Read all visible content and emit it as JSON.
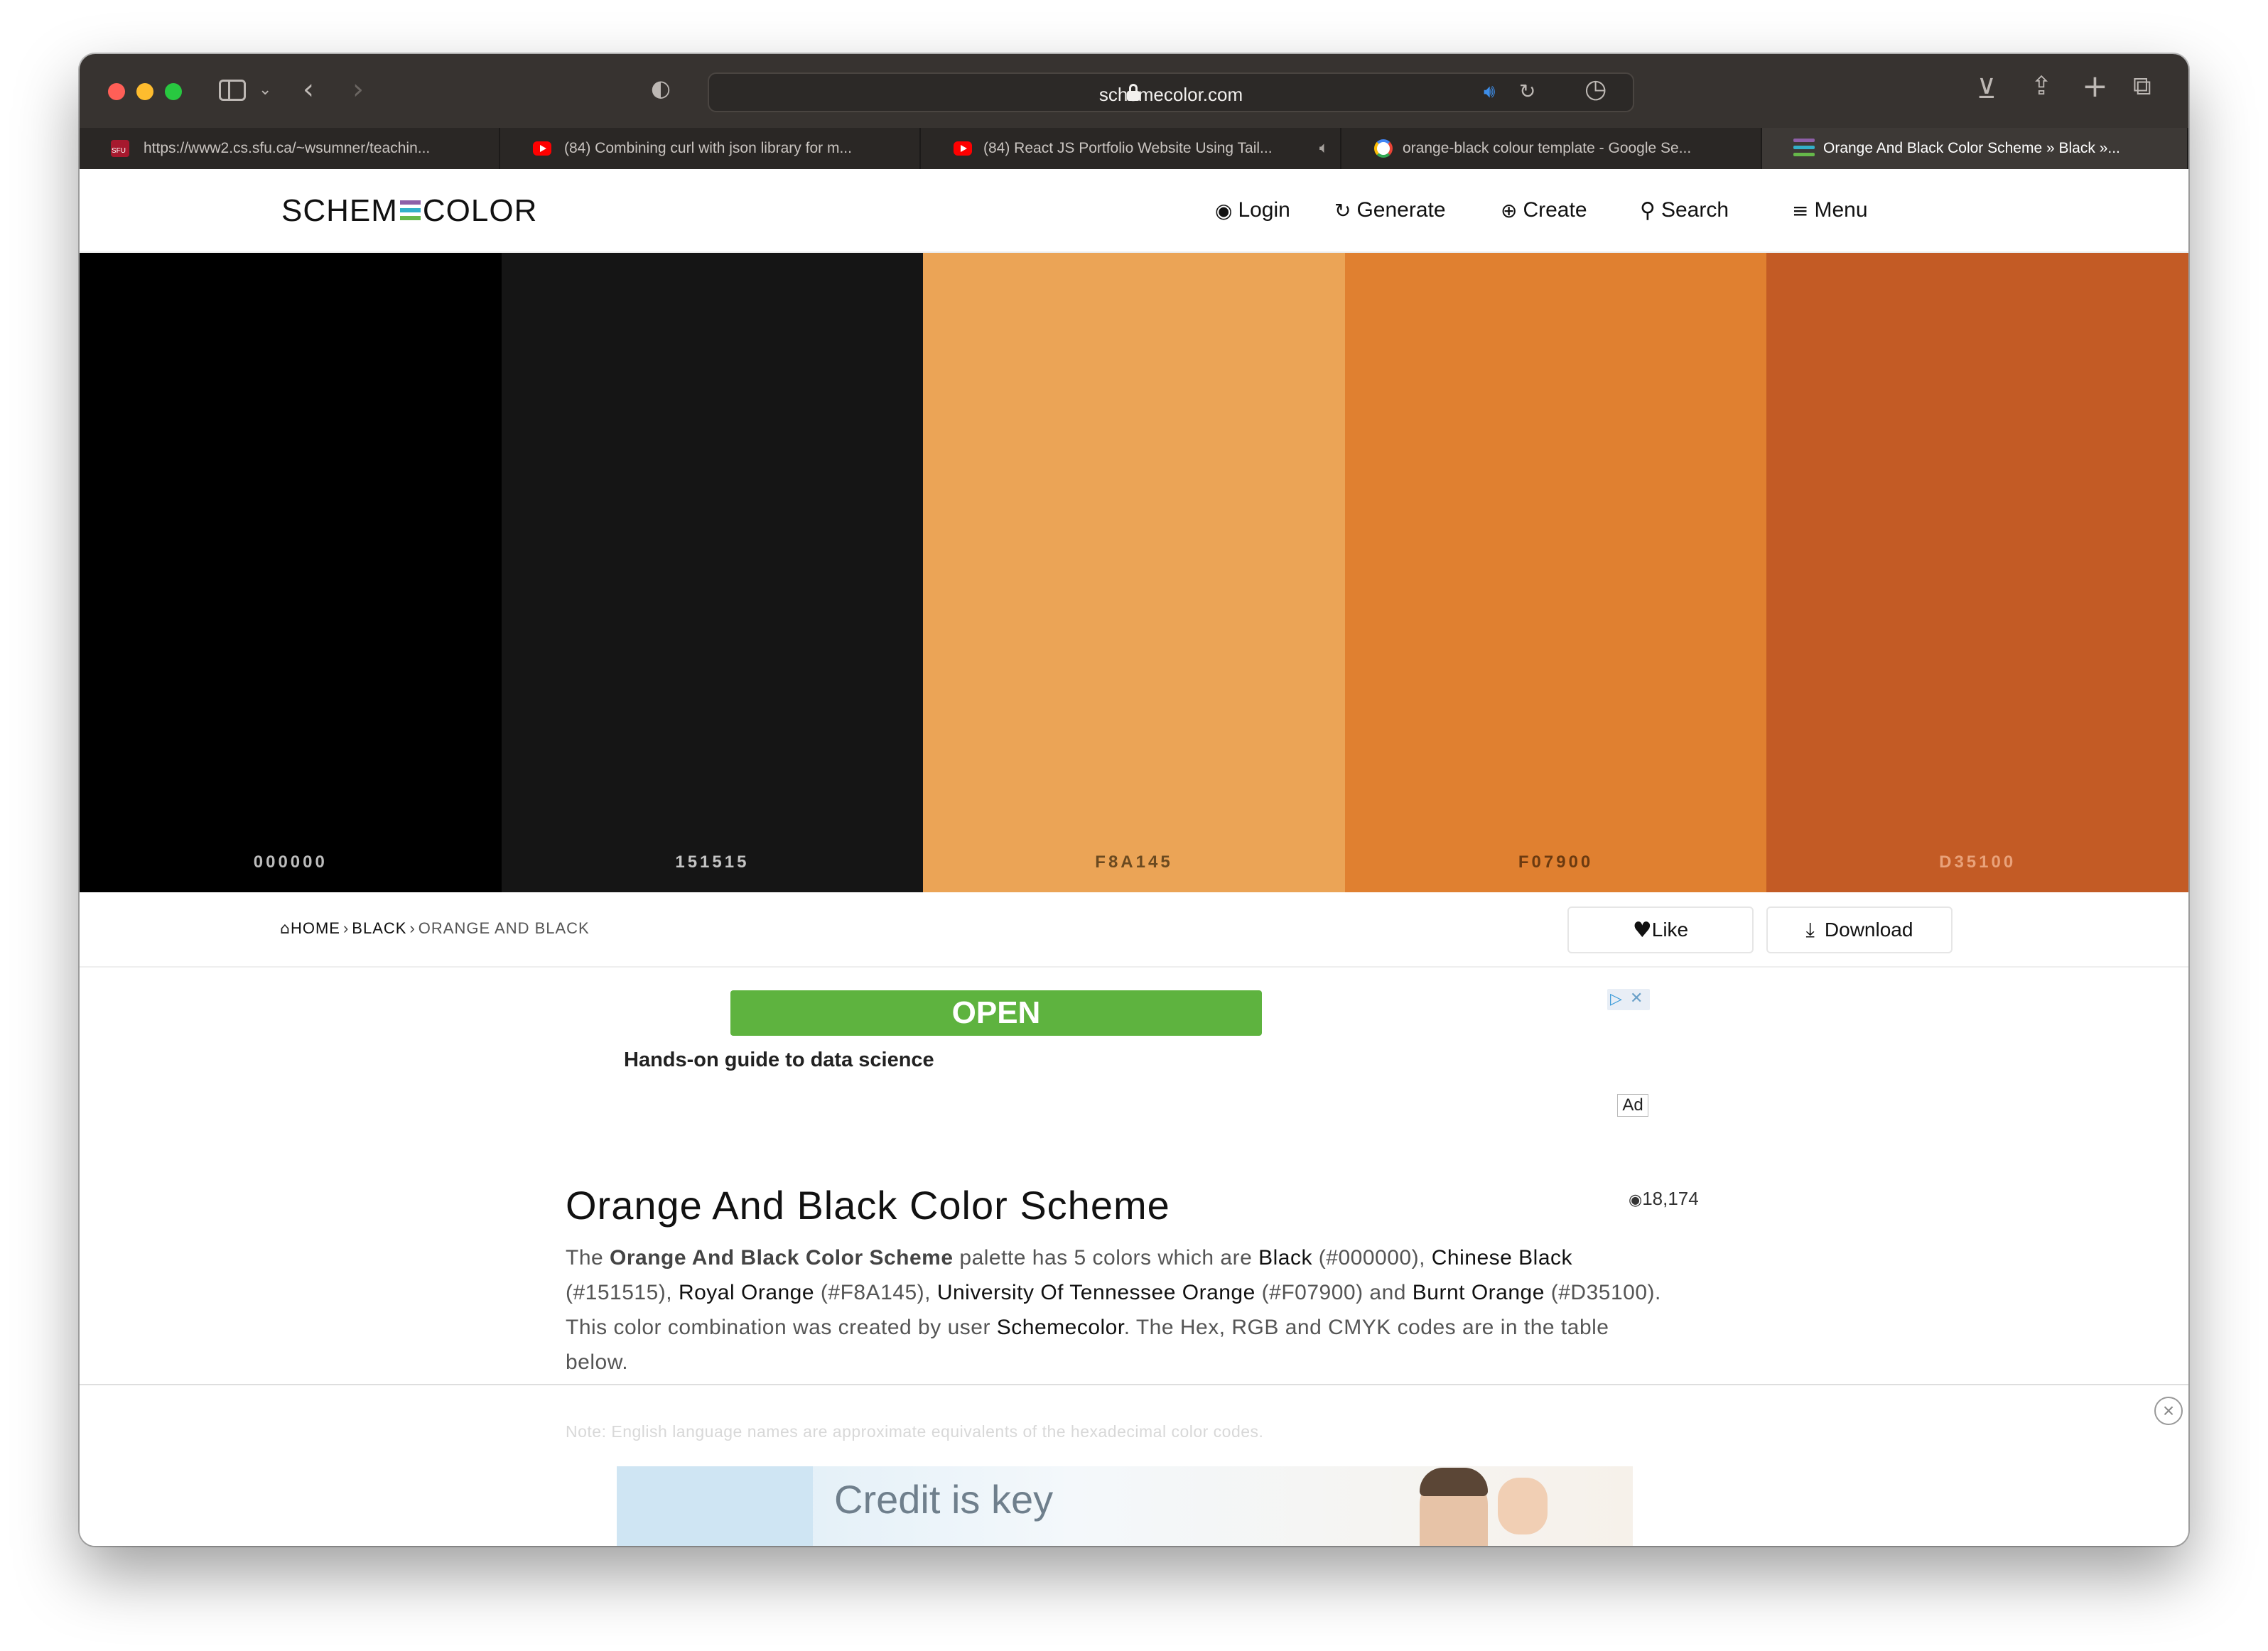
{
  "browser": {
    "url": "schemecolor.com",
    "tabs": [
      {
        "title": "https://www2.cs.sfu.ca/~wsumner/teachin...",
        "favicon": "sfu-icon"
      },
      {
        "title": "(84) Combining curl with json library for m...",
        "favicon": "youtube-icon"
      },
      {
        "title": "(84) React JS Portfolio Website Using Tail...",
        "favicon": "youtube-icon",
        "audio": true
      },
      {
        "title": "orange-black colour template - Google Se...",
        "favicon": "google-icon"
      },
      {
        "title": "Orange And Black Color Scheme » Black »...",
        "favicon": "schemecolor-icon",
        "active": true
      }
    ]
  },
  "site": {
    "logo_left": "SCHEM",
    "logo_right": "COLOR",
    "nav": {
      "login": "Login",
      "generate": "Generate",
      "create": "Create",
      "search": "Search",
      "menu": "Menu"
    }
  },
  "palette": [
    {
      "hex": "000000",
      "color": "#000000",
      "label_color": "#bcbcbc"
    },
    {
      "hex": "151515",
      "color": "#151515",
      "label_color": "#c4c4c4"
    },
    {
      "hex": "F8A145",
      "color": "#EBA456",
      "label_color": "#6b4a20"
    },
    {
      "hex": "F07900",
      "color": "#E08030",
      "label_color": "#6b3a10"
    },
    {
      "hex": "D35100",
      "color": "#C35B25",
      "label_color": "#e9a27a"
    }
  ],
  "breadcrumb": {
    "home": "HOME",
    "black": "BLACK",
    "current": "ORANGE AND BLACK"
  },
  "actions": {
    "like": "Like",
    "download": "Download"
  },
  "ad": {
    "open_label": "OPEN",
    "tagline": "Hands-on guide to data science",
    "badge": "Ad",
    "bottom_text": "Credit is key"
  },
  "article": {
    "title": "Orange And Black Color Scheme",
    "views": "18,174",
    "p1_the": "The ",
    "p1_name": "Orange And Black Color Scheme",
    "p1_mid": " palette has 5 colors which are ",
    "c1_name": "Black",
    "c1_hex": " (#000000), ",
    "c2_name": "Chinese Black",
    "c2_hex": " (#151515), ",
    "c3_name": "Royal Orange",
    "c3_hex": " (#F8A145), ",
    "c4_name": "University Of Tennessee Orange",
    "c4_hex": " (#F07900) and ",
    "c5_name": "Burnt Orange",
    "c5_hex": " (#D35100).",
    "p2_a": "This color combination was created by user ",
    "p2_user": "Schemecolor",
    "p2_b": ". The Hex, RGB and CMYK codes are in the table below.",
    "note": "Note: English language names are approximate equivalents of the hexadecimal color codes."
  },
  "colors": {
    "accent_green": "#5EB33F",
    "logo_e": [
      "#8e5fa8",
      "#33b0c9",
      "#66b84a"
    ]
  }
}
